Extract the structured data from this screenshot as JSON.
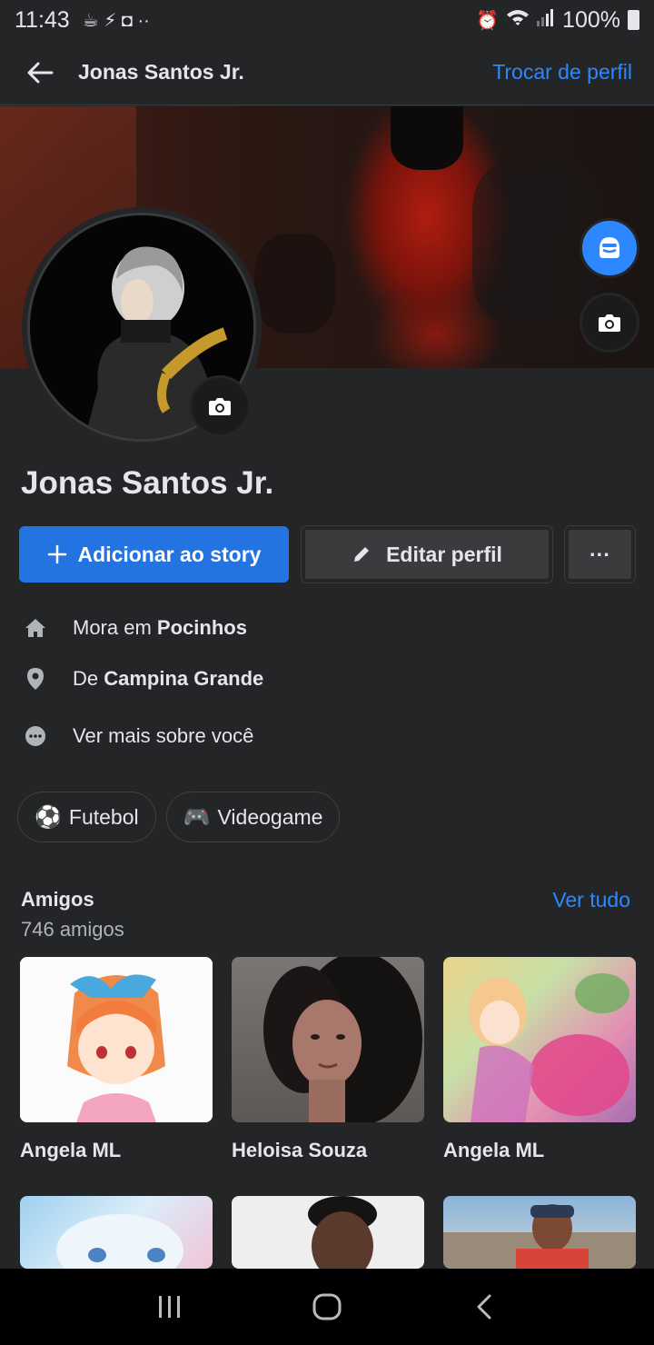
{
  "status_bar": {
    "time": "11:43",
    "battery": "100%"
  },
  "header": {
    "title": "Jonas Santos Jr.",
    "switch_profile": "Trocar de perfil"
  },
  "profile": {
    "name": "Jonas Santos Jr."
  },
  "actions": {
    "add_story": "Adicionar ao story",
    "edit_profile": "Editar perfil",
    "more": "···"
  },
  "info": {
    "lives_prefix": "Mora em ",
    "lives_city": "Pocinhos",
    "from_prefix": "De ",
    "from_city": "Campina Grande",
    "see_more": "Ver mais sobre você"
  },
  "hobbies": [
    {
      "emoji": "⚽",
      "label": "Futebol"
    },
    {
      "emoji": "🎮",
      "label": "Videogame"
    }
  ],
  "friends": {
    "title": "Amigos",
    "count": "746 amigos",
    "see_all": "Ver tudo",
    "items": [
      {
        "name": "Angela ML"
      },
      {
        "name": "Heloisa Souza"
      },
      {
        "name": "Angela ML"
      }
    ]
  },
  "colors": {
    "accent": "#2d88ff",
    "primary_button": "#2374e1",
    "background": "#242526",
    "surface": "#3a3b3c"
  },
  "icons": [
    "back-arrow-icon",
    "camera-icon",
    "avatar-icon",
    "plus-icon",
    "pencil-icon",
    "home-icon",
    "location-pin-icon",
    "more-dots-icon",
    "recent-apps-icon",
    "home-nav-icon",
    "back-nav-icon"
  ]
}
